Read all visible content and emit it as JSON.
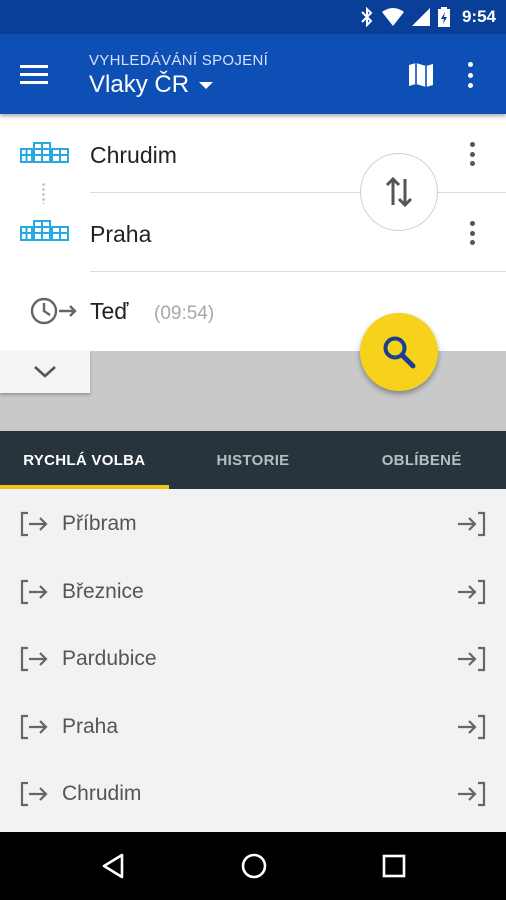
{
  "status_bar": {
    "time": "9:54"
  },
  "app_bar": {
    "subtitle": "VYHLEDÁVÁNÍ SPOJENÍ",
    "title": "Vlaky ČR"
  },
  "search": {
    "from": "Chrudim",
    "to": "Praha",
    "time_label": "Teď",
    "time_value": "(09:54)"
  },
  "tabs": [
    {
      "label": "RYCHLÁ VOLBA",
      "active": true
    },
    {
      "label": "HISTORIE",
      "active": false
    },
    {
      "label": "OBLÍBENÉ",
      "active": false
    }
  ],
  "quick_list": [
    {
      "label": "Příbram"
    },
    {
      "label": "Březnice"
    },
    {
      "label": "Pardubice"
    },
    {
      "label": "Praha"
    },
    {
      "label": "Chrudim"
    }
  ],
  "colors": {
    "status_bar": "#0a3f99",
    "app_bar": "#0e4fb5",
    "fab": "#f7d21c",
    "tab_bar": "#27343b",
    "tab_indicator": "#f2c21a",
    "station_icon": "#29a9e1"
  }
}
